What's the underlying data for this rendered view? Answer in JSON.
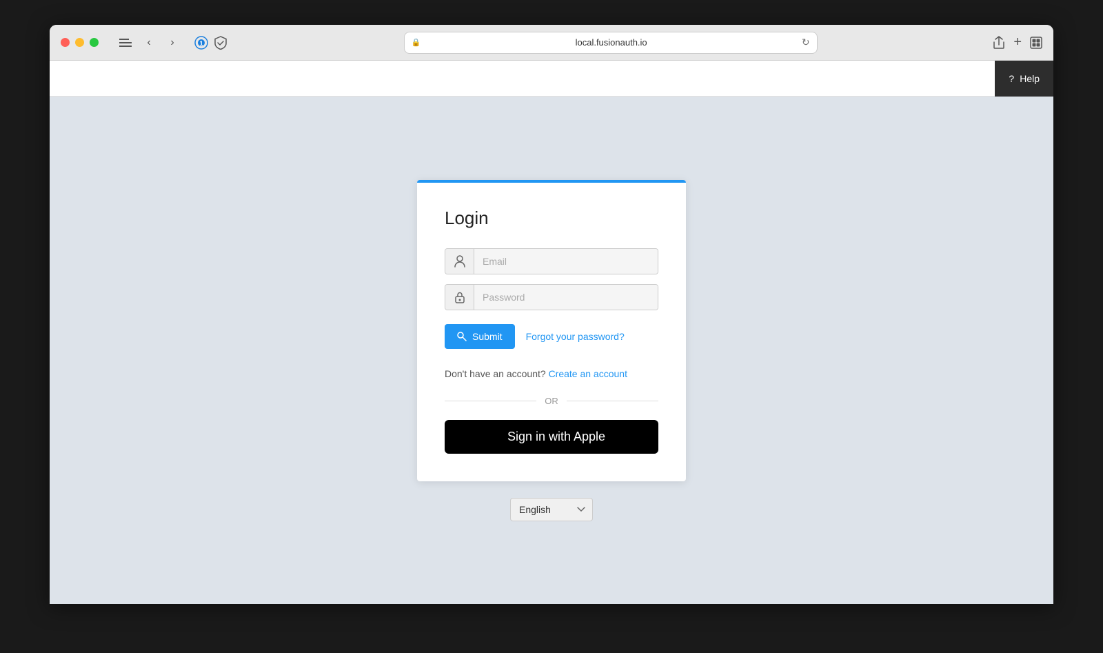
{
  "browser": {
    "url": "local.fusionauth.io",
    "help_label": "Help"
  },
  "page": {
    "title": "Login",
    "card": {
      "email_placeholder": "Email",
      "password_placeholder": "Password",
      "submit_label": "Submit",
      "forgot_password_label": "Forgot your password?",
      "no_account_text": "Don't have an account?",
      "create_account_label": "Create an account",
      "or_label": "OR",
      "apple_signin_label": "Sign in with Apple"
    }
  },
  "language": {
    "selected": "English"
  }
}
